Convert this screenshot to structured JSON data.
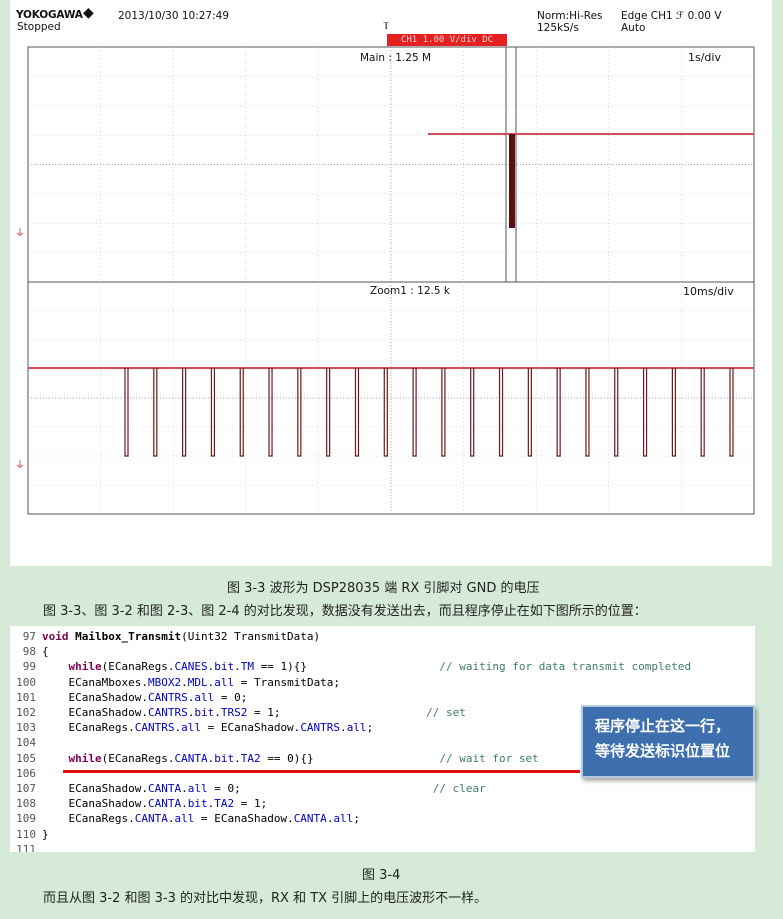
{
  "oscilloscope": {
    "brand": "YOKOGAWA",
    "datetime": "2013/10/30 10:27:49",
    "status": "Stopped",
    "acq_mode": "Norm:Hi-Res",
    "sample_rate": "125kS/s",
    "trigger": "Edge CH1 ℱ 0.00 V",
    "trigger_mode": "Auto",
    "red_bar_text": "CH1 1.00 V/div DC",
    "main_label": "Main : 1.25 M",
    "main_timebase": "1s/div",
    "zoom_label": "Zoom1 : 12.5 k",
    "zoom_timebase": "10ms/div",
    "trace_color": "#d0505a",
    "pulse_count": 22
  },
  "captions": {
    "fig_3_3": "图 3-3 波形为 DSP28035 端 RX 引脚对 GND 的电压",
    "para_1": "图 3-3、图 3-2 和图 2-3、图 2-4 的对比发现，数据没有发送出去，而且程序停止在如下图所示的位置：",
    "fig_3_4": "图 3-4",
    "para_2": "而且从图 3-2 和图 3-3 的对比中发现，RX 和 TX 引脚上的电压波形不一样。"
  },
  "code_lines": [
    {
      "n": "97",
      "html": "<span class=\"kw\">void</span> <b>Mailbox_Transmit</b>(Uint32 TransmitData)"
    },
    {
      "n": "98",
      "html": "{"
    },
    {
      "n": "99",
      "html": "    <span class=\"kw\">while</span>(ECanaRegs.<span class=\"field\">CANES</span>.<span class=\"field\">bit</span>.<span class=\"field\">TM</span> == 1){}                    <span class=\"cm\">// waiting for data transmit completed</span>"
    },
    {
      "n": "100",
      "html": "    ECanaMboxes.<span class=\"field\">MBOX2</span>.<span class=\"field\">MDL</span>.<span class=\"field\">all</span> = TransmitData;"
    },
    {
      "n": "101",
      "html": "    ECanaShadow.<span class=\"field\">CANTRS</span>.<span class=\"field\">all</span> = 0;"
    },
    {
      "n": "102",
      "html": "    ECanaShadow.<span class=\"field\">CANTRS</span>.<span class=\"field\">bit</span>.<span class=\"field\">TRS2</span> = 1;                      <span class=\"cm\">// set</span>"
    },
    {
      "n": "103",
      "html": "    ECanaRegs.<span class=\"field\">CANTRS</span>.<span class=\"field\">all</span> = ECanaShadow.<span class=\"field\">CANTRS</span>.<span class=\"field\">all</span>;"
    },
    {
      "n": "104",
      "html": ""
    },
    {
      "n": "105",
      "html": "    <span class=\"kw\">while</span>(ECanaRegs.<span class=\"field\">CANTA</span>.<span class=\"field\">bit</span>.<span class=\"field\">TA2</span> == 0){}                   <span class=\"cm\">// wait for set</span>"
    },
    {
      "n": "106",
      "html": ""
    },
    {
      "n": "107",
      "html": "    ECanaShadow.<span class=\"field\">CANTA</span>.<span class=\"field\">all</span> = 0;                             <span class=\"cm\">// clear</span>"
    },
    {
      "n": "108",
      "html": "    ECanaShadow.<span class=\"field\">CANTA</span>.<span class=\"field\">bit</span>.<span class=\"field\">TA2</span> = 1;"
    },
    {
      "n": "109",
      "html": "    ECanaRegs.<span class=\"field\">CANTA</span>.<span class=\"field\">all</span> = ECanaShadow.<span class=\"field\">CANTA</span>.<span class=\"field\">all</span>;"
    },
    {
      "n": "110",
      "html": "}"
    },
    {
      "n": "111",
      "html": ""
    }
  ],
  "callout": {
    "line1": "程序停止在这一行，",
    "line2": "等待发送标识位置位",
    "bg_color": "#3d6eae"
  }
}
